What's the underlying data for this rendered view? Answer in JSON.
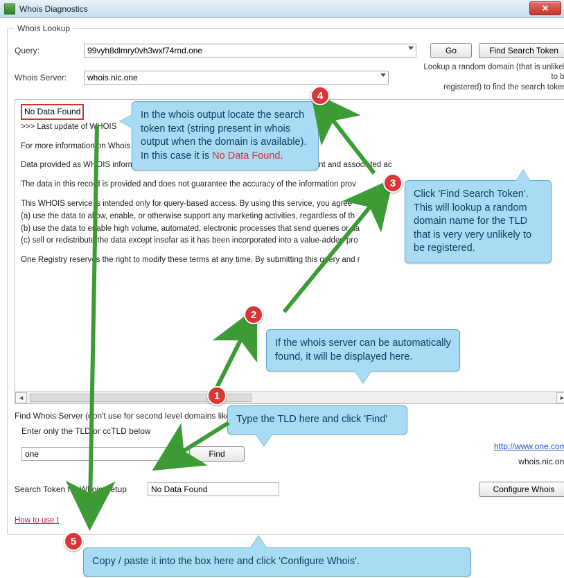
{
  "window": {
    "title": "Whois Diagnostics",
    "close_glyph": "✕"
  },
  "lookup": {
    "legend": "Whois Lookup",
    "query_label": "Query:",
    "query_value": "99vyh8dlmry0vh3wxf74rnd.one",
    "server_label": "Whois Server:",
    "server_value": "whois.nic.one",
    "go_label": "Go",
    "find_token_label": "Find Search Token",
    "hint_line1": "Lookup a random domain (that is unlikely to be",
    "hint_line2": "registered) to find the search token."
  },
  "output": {
    "no_data": "No Data Found",
    "lines": [
      ">>> Last update of WHOIS",
      "For more information on Whois s",
      "Data provided as WHOIS information                                                                  contact information for a domain name registrant and associated ac",
      "The data in this record is provided                                                                                    and does not guarantee the accuracy of the information prov",
      "This WHOIS service is intended only for query-based access. By using this service, you agree",
      "  (a) use the data to allow, enable, or otherwise support any marketing activities, regardless of th",
      "  (b) use the data to enable high volume, automated, electronic processes that send queries or da",
      "  (c) sell or redistribute the data except insofar as it has been incorporated into a value-added pro",
      "One Registry reserves the right to modify these terms at any time. By submitting this query and r"
    ]
  },
  "find": {
    "heading": "Find Whois Server (don't use for second level domains like uk.",
    "enter_label": "Enter only the TLD or ccTLD below",
    "tld_value": "one",
    "find_label": "Find",
    "link_url": "http://www.one.com/",
    "server_echo": "whois.nic.one",
    "search_token_label": "Search Token for Whois Setup",
    "search_token_value": "No Data Found",
    "configure_label": "Configure Whois",
    "howto_link": "How to use t"
  },
  "callouts": {
    "c4": "In the whois output locate the search token text (string present in whois output when the domain is available). In this case it is ",
    "c4_hl": "No Data Found",
    "c4_tail": ".",
    "c3": "Click 'Find Search Token'. This will lookup a random domain name for the TLD that is very very unlikely to be registered.",
    "c2": "If the whois server can be automatically found, it will be displayed here.",
    "c1": "Type the TLD here and click 'Find'",
    "c5": "Copy / paste it into the box here and click 'Configure Whois'."
  },
  "badges": {
    "b1": "1",
    "b2": "2",
    "b3": "3",
    "b4": "4",
    "b5": "5"
  }
}
